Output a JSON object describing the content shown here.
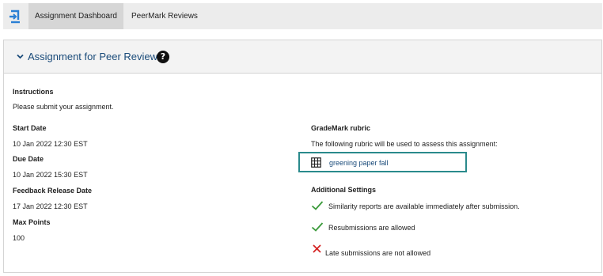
{
  "nav": {
    "tabs": [
      {
        "label": "Assignment Dashboard",
        "active": true
      },
      {
        "label": "PeerMark Reviews",
        "active": false
      }
    ]
  },
  "panel": {
    "title": "Assignment for Peer Review",
    "help_icon": "?"
  },
  "details": {
    "instructions_label": "Instructions",
    "instructions_value": "Please submit your assignment.",
    "start_label": "Start Date",
    "start_value": "10 Jan 2022 12:30 EST",
    "due_label": "Due Date",
    "due_value": "10 Jan 2022 15:30 EST",
    "feedback_label": "Feedback Release Date",
    "feedback_value": "17 Jan 2022 12:30 EST",
    "max_label": "Max Points",
    "max_value": "100"
  },
  "rubric": {
    "label": "GradeMark rubric",
    "description": "The following rubric will be used to assess this assignment:",
    "name": "greening paper fall",
    "icon": "grid-icon"
  },
  "settings": {
    "label": "Additional Settings",
    "items": [
      {
        "text": "Similarity reports are available immediately after submission.",
        "status": "enabled",
        "icon": "check-icon"
      },
      {
        "text": "Resubmissions are allowed",
        "status": "enabled",
        "icon": "check-icon"
      },
      {
        "text": "Late submissions are not allowed",
        "status": "disabled",
        "icon": "cross-icon"
      }
    ]
  },
  "colors": {
    "accent_link": "#1a4b7a",
    "check": "#3a9a3a",
    "cross": "#d42020",
    "highlight_border": "#2a8a8c"
  }
}
